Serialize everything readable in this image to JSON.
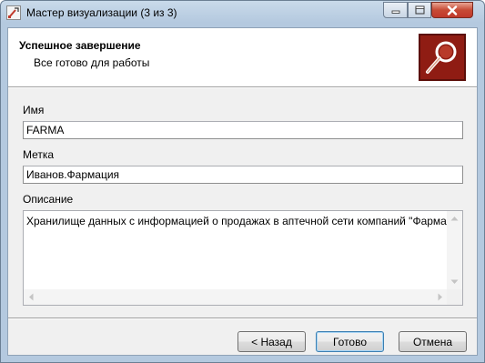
{
  "window": {
    "title": "Мастер визуализации (3 из 3)",
    "accent": "#8f1c13",
    "close_color": "#c0392b"
  },
  "header": {
    "title": "Успешное завершение",
    "subtitle": "Все готово для работы",
    "image_icon": "magnifier-icon"
  },
  "form": {
    "name_label": "Имя",
    "name_value": "FARMA",
    "tag_label": "Метка",
    "tag_value": "Иванов.Фармация",
    "description_label": "Описание",
    "description_value": "Хранилище данных с информацией о продажах в аптечной сети компаний \"Фарма-Х\""
  },
  "buttons": {
    "back": "< Назад",
    "finish": "Готово",
    "cancel": "Отмена"
  }
}
